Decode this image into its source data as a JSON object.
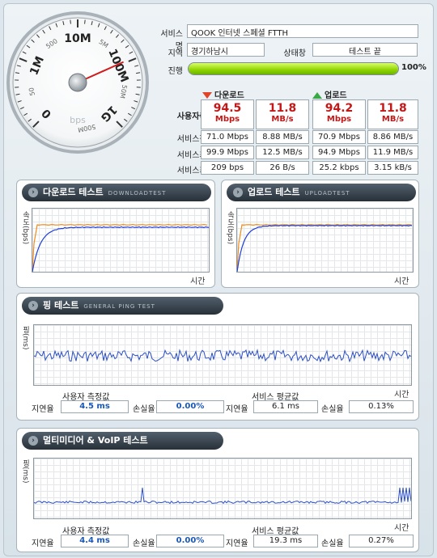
{
  "service": {
    "service_name_label": "서비스명",
    "service_name": "QOOK 인터넷 스페셜 FTTH",
    "region_label": "지역",
    "region": "경기하남시",
    "status_label": "상태창",
    "status": "테스트 끝",
    "progress_label": "진행",
    "progress_percent": 100,
    "progress_text": "100%"
  },
  "gauge": {
    "ticks": [
      "0",
      "1M",
      "10M",
      "100M",
      "1G"
    ],
    "small_ticks": [
      "50",
      "500",
      "5M",
      "50M",
      "500M"
    ],
    "unit": "bps",
    "needle_value": "94.5 Mbps"
  },
  "results": {
    "download_title": "다운로드",
    "upload_title": "업로드",
    "measured_label": "사용자측정값",
    "download_mbps": "94.5",
    "download_mbps_unit": "Mbps",
    "download_mbs": "11.8",
    "download_mbs_unit": "MB/s",
    "upload_mbps": "94.2",
    "upload_mbps_unit": "Mbps",
    "upload_mbs": "11.8",
    "upload_mbs_unit": "MB/s",
    "rows": [
      {
        "label": "서비스평균값",
        "dl_mbps": "71.0 Mbps",
        "dl_mbs": "8.88 MB/s",
        "ul_mbps": "70.9 Mbps",
        "ul_mbs": "8.86 MB/s"
      },
      {
        "label": "서비스최대값",
        "dl_mbps": "99.9 Mbps",
        "dl_mbs": "12.5 MB/s",
        "ul_mbps": "94.9 Mbps",
        "ul_mbs": "11.9 MB/s"
      },
      {
        "label": "서비스최소값",
        "dl_mbps": "209 bps",
        "dl_mbs": "26 B/s",
        "ul_mbps": "25.2 kbps",
        "ul_mbs": "3.15 kB/s"
      }
    ]
  },
  "panels": {
    "download": {
      "title": "다운로드 테스트",
      "sub": "DOWNLOADTEST",
      "ylabel": "속도(bps)",
      "xlabel": "시간"
    },
    "upload": {
      "title": "업로드 테스트",
      "sub": "UPLOADTEST",
      "ylabel": "속도(bps)",
      "xlabel": "시간"
    },
    "ping": {
      "title": "핑 테스트",
      "sub": "GENERAL PING TEST",
      "ylabel": "핑(ms)",
      "xlabel": "시간",
      "user_label": "사용자 측정값",
      "service_label": "서비스 평균값",
      "latency_label": "지연율",
      "loss_label": "손실율",
      "user_latency": "4.5 ms",
      "user_loss": "0.00%",
      "service_latency": "6.1 ms",
      "service_loss": "0.13%"
    },
    "voip": {
      "title": "멀티미디어 & VoIP 테스트",
      "ylabel": "핑(ms)",
      "xlabel": "시간",
      "user_label": "사용자 측정값",
      "service_label": "서비스 평균값",
      "latency_label": "지연율",
      "loss_label": "손실율",
      "user_latency": "4.4 ms",
      "user_loss": "0.00%",
      "service_latency": "19.3 ms",
      "service_loss": "0.27%"
    }
  },
  "colors": {
    "user_line": "#1f3fd6",
    "service_line": "#f08a1a",
    "ping_line": "#2a4ec8",
    "value_red": "#c31818",
    "value_blue": "#1a58b8"
  }
}
